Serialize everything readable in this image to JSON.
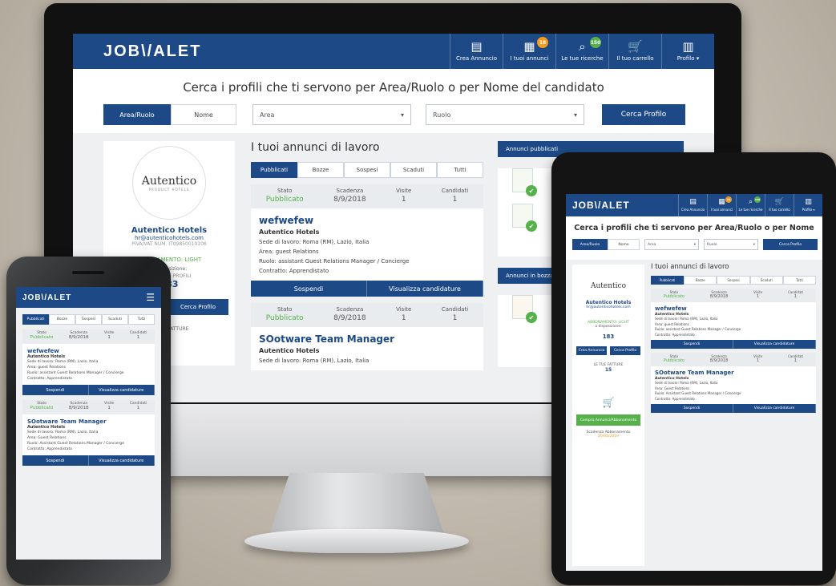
{
  "app": {
    "logo": "JOB\\/ALET",
    "nav": [
      {
        "label": "Crea Annuncio",
        "icon": "create-ad-icon",
        "badge": ""
      },
      {
        "label": "I tuoi annunci",
        "icon": "ads-icon",
        "badge": "18"
      },
      {
        "label": "Le tue ricerche",
        "icon": "searches-icon",
        "badge": "150"
      },
      {
        "label": "Il tuo carrello",
        "icon": "cart-icon",
        "badge": ""
      },
      {
        "label": "Profilo ▾",
        "icon": "building-icon",
        "badge": ""
      }
    ],
    "colors": {
      "primary": "#1d4a86",
      "accent_green": "#56b14b",
      "badge_orange": "#f39a1f"
    }
  },
  "search": {
    "title": "Cerca i profili che ti servono per Area/Ruolo o per Nome del candidato",
    "title_tablet": "Cerca i profili che ti servono per Area/Ruolo o per Nome",
    "mode_tabs": [
      "Area/Ruolo",
      "Nome"
    ],
    "area_placeholder": "Area",
    "ruolo_placeholder": "Ruolo",
    "button": "Cerca Profilo"
  },
  "profile": {
    "brand": "Autentico",
    "brand_sub": "PRODUCT HOTELS",
    "company": "Autentico Hotels",
    "email": "hr@autenticohotels.com",
    "piva": "PIVA/VAT NUM. IT09850010106",
    "plan": "ABBONAMENTO: LIGHT",
    "label_disposizione": "a disposizione:",
    "label_ricerche": "RICERCHE PROFILI",
    "value_ricerche": "183",
    "cta_cerca": "Cerca Profilo",
    "cta_crea": "Crea Annuncio",
    "fatture_label": "LE TUE FATTURE",
    "fatture_count": "15",
    "shop_button": "Compra Annunci/Abbonamento",
    "scadenza_label": "Scadenza Abbonamento",
    "scadenza_value": "20/05/2019"
  },
  "ads": {
    "heading": "I tuoi annunci di lavoro",
    "tabs": [
      "Pubblicati",
      "Bozze",
      "Sospesi",
      "Scaduti",
      "Tutti"
    ],
    "status_labels": [
      "Stato",
      "Scadenza",
      "Visite",
      "Candidati"
    ],
    "items": [
      {
        "stato": "Pubblicato",
        "scadenza": "8/9/2018",
        "visite": "1",
        "candidati": "1",
        "title": "wefwefew",
        "company": "Autentico Hotels",
        "sede": "Sede di lavoro: Roma (RM), Lazio, Italia",
        "area": "Area: guest Relations",
        "ruolo": "Ruolo: assistant Guest Relations Manager / Concierge",
        "contratto": "Contratto: Apprendistato"
      },
      {
        "stato": "Pubblicato",
        "scadenza": "8/9/2018",
        "visite": "1",
        "candidati": "1",
        "title": "SOotware Team Manager",
        "company": "Autentico Hotels",
        "sede": "Sede di lavoro: Roma (RM), Lazio, Italia",
        "area": "Area: Guest Relations",
        "ruolo": "Ruolo: Assistant Guest Relations Manager / Concierge",
        "contratto": "Contratto: Apprendistato"
      }
    ],
    "action_suspend": "Sospendi",
    "action_view": "Visualizza candidature"
  },
  "right_panel": {
    "published_title": "Annunci pubblicati",
    "draft_title": "Annunci in bozza"
  }
}
